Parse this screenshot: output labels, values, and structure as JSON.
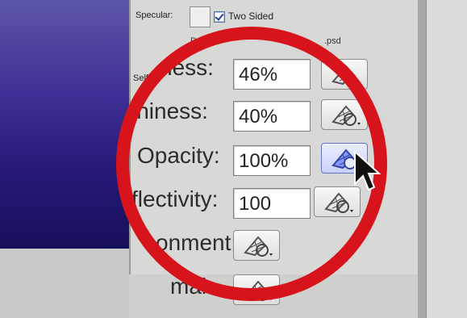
{
  "top_row": {
    "specular_label": "Specular:",
    "two_sided_label": "Two Sided",
    "two_sided_checked": true,
    "under_label": "D",
    "file_label": ".psd"
  },
  "rows": [
    {
      "label": "ness:",
      "small_prefix": "Self",
      "value": "46%",
      "icon": "map-texture-icon"
    },
    {
      "label": "ininess:",
      "value": "40%",
      "icon": "map-texture-icon"
    },
    {
      "label": "Opacity:",
      "value": "100%",
      "icon": "map-texture-icon",
      "active": true
    },
    {
      "label": "flectivity:",
      "value": "100",
      "icon": "map-texture-icon"
    },
    {
      "label": "onment:",
      "icon": "map-texture-icon"
    },
    {
      "label": "mal:",
      "icon": "map-texture-icon"
    }
  ],
  "colors": {
    "viewport": "#251877",
    "ring": "#d7141b",
    "active_button": "#c8d0ff"
  }
}
